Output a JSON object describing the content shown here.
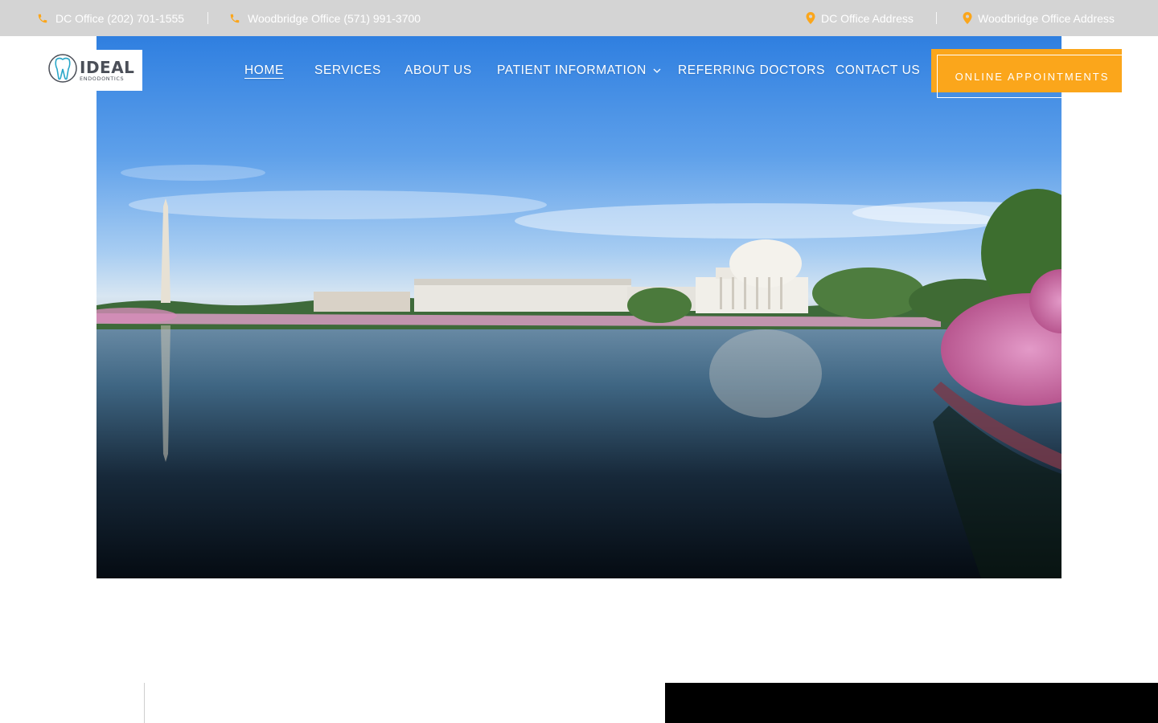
{
  "topbar": {
    "dc_phone": "DC Office (202) 701-1555",
    "woodbridge_phone": "Woodbridge Office (571) 991-3700",
    "dc_address": "DC Office Address",
    "woodbridge_address": "Woodbridge Office Address",
    "icon_color": "#fba61b"
  },
  "brand": {
    "logo_main": "IDEAL",
    "logo_sub": "ENDODONTICS"
  },
  "nav": {
    "items": [
      {
        "label": "HOME",
        "active": true
      },
      {
        "label": "SERVICES"
      },
      {
        "label": "ABOUT US"
      },
      {
        "label": "PATIENT INFORMATION",
        "has_dropdown": true
      },
      {
        "label": "REFERRING DOCTORS"
      },
      {
        "label": "CONTACT US"
      }
    ],
    "cta_label": "ONLINE APPOINTMENTS"
  },
  "colors": {
    "accent": "#fba61b",
    "topbar_bg": "#d4d4d4"
  }
}
